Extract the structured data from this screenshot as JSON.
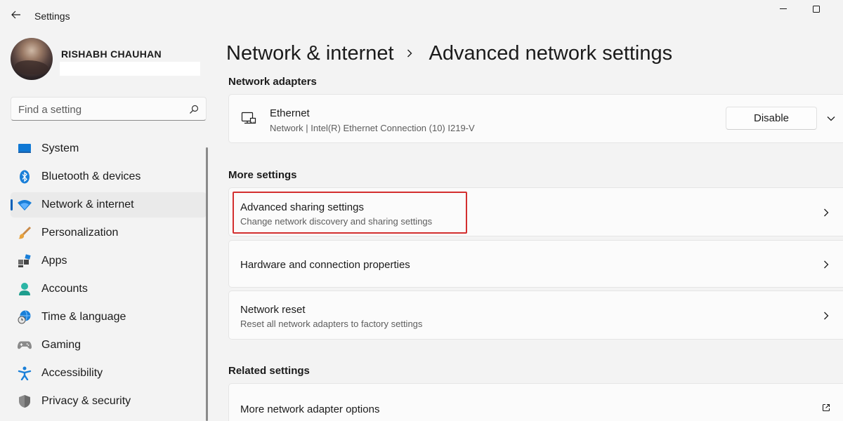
{
  "window": {
    "title": "Settings",
    "back_icon": "arrow-left-icon",
    "minimize_icon": "minimize-icon",
    "maximize_icon": "maximize-icon"
  },
  "user": {
    "name": "RISHABH CHAUHAN"
  },
  "search": {
    "placeholder": "Find a setting",
    "icon": "search-icon"
  },
  "sidebar": {
    "items": [
      {
        "label": "System",
        "icon": "system-icon",
        "active": false
      },
      {
        "label": "Bluetooth & devices",
        "icon": "bluetooth-icon",
        "active": false
      },
      {
        "label": "Network & internet",
        "icon": "wifi-icon",
        "active": true
      },
      {
        "label": "Personalization",
        "icon": "brush-icon",
        "active": false
      },
      {
        "label": "Apps",
        "icon": "apps-icon",
        "active": false
      },
      {
        "label": "Accounts",
        "icon": "person-icon",
        "active": false
      },
      {
        "label": "Time & language",
        "icon": "globe-clock-icon",
        "active": false
      },
      {
        "label": "Gaming",
        "icon": "gamepad-icon",
        "active": false
      },
      {
        "label": "Accessibility",
        "icon": "accessibility-icon",
        "active": false
      },
      {
        "label": "Privacy & security",
        "icon": "shield-icon",
        "active": false
      }
    ]
  },
  "breadcrumb": {
    "parent": "Network & internet",
    "current": "Advanced network settings"
  },
  "sections": {
    "adapters_title": "Network adapters",
    "more_title": "More settings",
    "related_title": "Related settings"
  },
  "adapter": {
    "name": "Ethernet",
    "description": "Network | Intel(R) Ethernet Connection (10) I219-V",
    "button": "Disable"
  },
  "more_settings": [
    {
      "title": "Advanced sharing settings",
      "subtitle": "Change network discovery and sharing settings"
    },
    {
      "title": "Hardware and connection properties",
      "subtitle": ""
    },
    {
      "title": "Network reset",
      "subtitle": "Reset all network adapters to factory settings"
    }
  ],
  "related_settings": [
    {
      "title": "More network adapter options",
      "icon": "external-link-icon"
    }
  ],
  "colors": {
    "accent": "#005fb8",
    "highlight": "#d32f2f",
    "background": "#f3f3f3",
    "card": "#fbfbfb"
  }
}
